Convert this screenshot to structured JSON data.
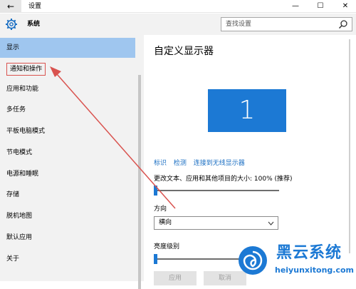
{
  "window": {
    "back_glyph": "←",
    "title": "设置",
    "minimize_glyph": "—",
    "maximize_glyph": "☐",
    "close_glyph": "✕"
  },
  "header": {
    "icon": "gear-icon",
    "label": "系统",
    "search_placeholder": "查找设置"
  },
  "sidebar": {
    "items": [
      {
        "label": "显示"
      },
      {
        "label": "通知和操作"
      },
      {
        "label": "应用和功能"
      },
      {
        "label": "多任务"
      },
      {
        "label": "平板电脑模式"
      },
      {
        "label": "节电模式"
      },
      {
        "label": "电源和睡眠"
      },
      {
        "label": "存储"
      },
      {
        "label": "脱机地图"
      },
      {
        "label": "默认应用"
      },
      {
        "label": "关于"
      }
    ]
  },
  "main": {
    "title": "自定义显示器",
    "monitor_number": "1",
    "links": {
      "identify": "标识",
      "detect": "检测",
      "wireless": "连接到无线显示器"
    },
    "scale_label": "更改文本、应用和其他项目的大小: 100% (推荐)",
    "scale_level": 0,
    "orientation_label": "方向",
    "orientation_value": "横向",
    "brightness_label": "亮度级别",
    "brightness_level": 0,
    "apply_button": "应用",
    "cancel_button": "取消"
  },
  "colors": {
    "accent": "#1c79d4",
    "selected": "#9fc6ef",
    "annotation": "#d9534f"
  },
  "watermark": {
    "title": "黑云系统",
    "url": "heiyunxitong.com"
  }
}
